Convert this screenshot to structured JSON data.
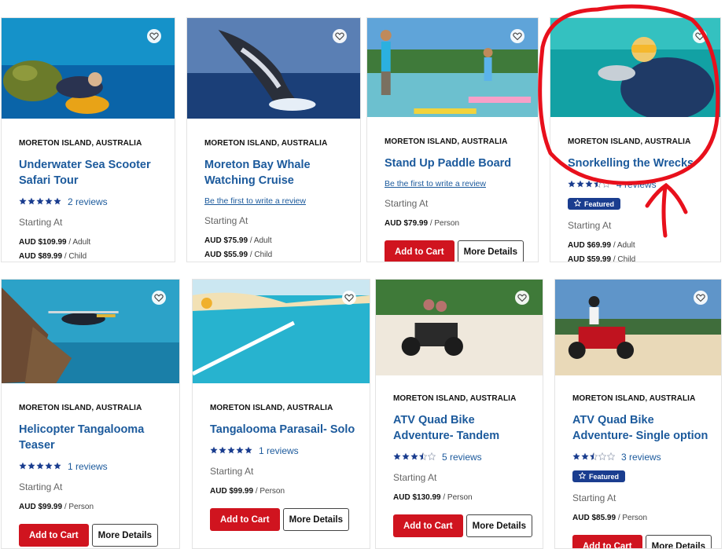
{
  "cards": [
    {
      "location": "MORETON ISLAND, AUSTRALIA",
      "title": "Underwater Sea Scooter Safari Tour",
      "stars": 5,
      "reviews": "2 reviews",
      "starting_label": "Starting At",
      "prices": [
        {
          "amount": "AUD $109.99",
          "unit": "/ Adult"
        },
        {
          "amount": "AUD $89.99",
          "unit": "/ Child"
        }
      ]
    },
    {
      "location": "MORETON ISLAND, AUSTRALIA",
      "title": "Moreton Bay Whale Watching Cruise",
      "first_review": "Be the first to write a review",
      "starting_label": "Starting At",
      "prices": [
        {
          "amount": "AUD $75.99",
          "unit": "/ Adult"
        },
        {
          "amount": "AUD $55.99",
          "unit": "/ Child"
        }
      ]
    },
    {
      "location": "MORETON ISLAND, AUSTRALIA",
      "title": "Stand Up Paddle Board",
      "first_review": "Be the first to write a review",
      "starting_label": "Starting At",
      "prices": [
        {
          "amount": "AUD $79.99",
          "unit": "/ Person"
        }
      ],
      "add_to_cart": "Add to Cart",
      "more_details": "More Details"
    },
    {
      "location": "MORETON ISLAND, AUSTRALIA",
      "title": "Snorkelling the Wrecks",
      "stars": 3.5,
      "reviews": "4 reviews",
      "featured": "Featured",
      "starting_label": "Starting At",
      "prices": [
        {
          "amount": "AUD $69.99",
          "unit": "/ Adult"
        },
        {
          "amount": "AUD $59.99",
          "unit": "/ Child"
        }
      ]
    },
    {
      "location": "MORETON ISLAND, AUSTRALIA",
      "title": "Helicopter Tangalooma Teaser",
      "stars": 5,
      "reviews": "1 reviews",
      "starting_label": "Starting At",
      "prices": [
        {
          "amount": "AUD $99.99",
          "unit": "/ Person"
        }
      ],
      "add_to_cart": "Add to Cart",
      "more_details": "More Details"
    },
    {
      "location": "MORETON ISLAND, AUSTRALIA",
      "title": "Tangalooma Parasail- Solo",
      "stars": 5,
      "reviews": "1 reviews",
      "starting_label": "Starting At",
      "prices": [
        {
          "amount": "AUD $99.99",
          "unit": "/ Person"
        }
      ],
      "add_to_cart": "Add to Cart",
      "more_details": "More Details"
    },
    {
      "location": "MORETON ISLAND, AUSTRALIA",
      "title": "ATV Quad Bike Adventure- Tandem",
      "stars": 3.5,
      "reviews": "5 reviews",
      "starting_label": "Starting At",
      "prices": [
        {
          "amount": "AUD $130.99",
          "unit": "/ Person"
        }
      ],
      "add_to_cart": "Add to Cart",
      "more_details": "More Details"
    },
    {
      "location": "MORETON ISLAND, AUSTRALIA",
      "title": "ATV Quad Bike Adventure- Single option",
      "stars": 2.5,
      "reviews": "3 reviews",
      "featured": "Featured",
      "starting_label": "Starting At",
      "prices": [
        {
          "amount": "AUD $85.99",
          "unit": "/ Person"
        }
      ],
      "add_to_cart": "Add to Cart",
      "more_details": "More Details"
    }
  ],
  "colors": {
    "title_blue": "#1c5a9c",
    "cart_red": "#d0141f",
    "featured_navy": "#1a3d8f",
    "annotation_red": "#e8101c",
    "star_filled": "#1a3d8f"
  },
  "icons": [
    "heart-icon",
    "star-icon",
    "featured-star-icon"
  ]
}
